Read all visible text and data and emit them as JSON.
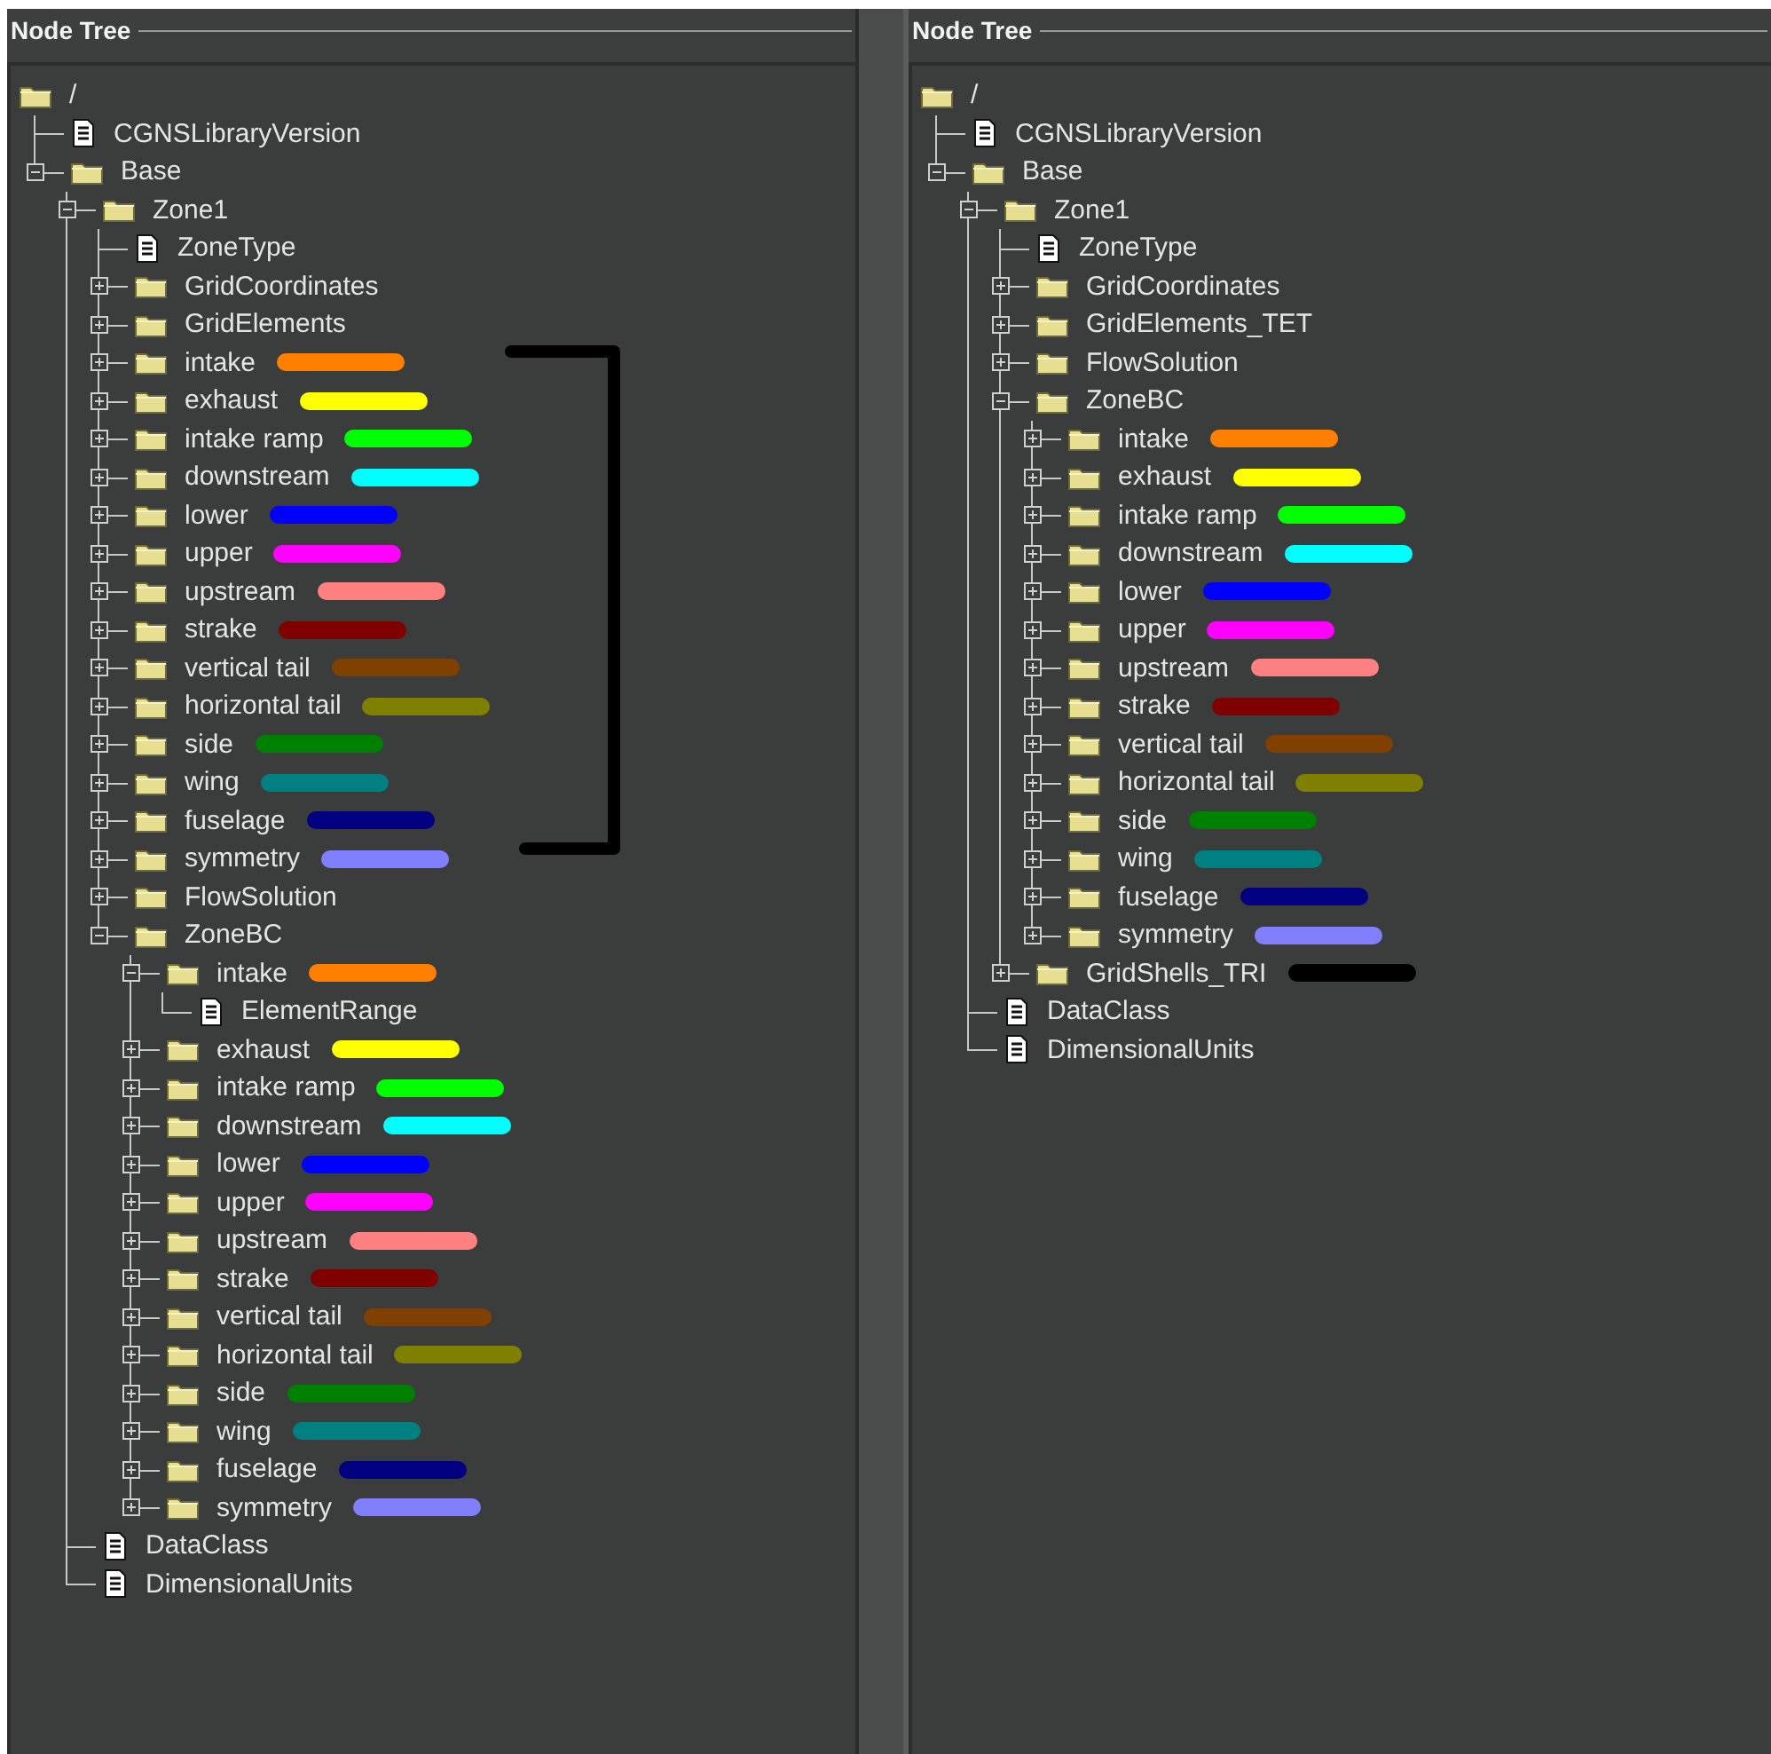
{
  "panels": [
    {
      "title": "Node Tree",
      "bracket": true,
      "tree": {
        "label": "/",
        "kind": "folder",
        "children": [
          {
            "label": "CGNSLibraryVersion",
            "kind": "file"
          },
          {
            "label": "Base",
            "kind": "folder",
            "expanded": true,
            "children": [
              {
                "label": "Zone1",
                "kind": "folder",
                "expanded": true,
                "children": [
                  {
                    "label": "ZoneType",
                    "kind": "file"
                  },
                  {
                    "label": "GridCoordinates",
                    "kind": "folder",
                    "expanded": false
                  },
                  {
                    "label": "GridElements",
                    "kind": "folder",
                    "expanded": false
                  },
                  {
                    "label": "intake",
                    "kind": "folder",
                    "expanded": false,
                    "color": "#ff8000"
                  },
                  {
                    "label": "exhaust",
                    "kind": "folder",
                    "expanded": false,
                    "color": "#ffff00"
                  },
                  {
                    "label": "intake ramp",
                    "kind": "folder",
                    "expanded": false,
                    "color": "#00ff00"
                  },
                  {
                    "label": "downstream",
                    "kind": "folder",
                    "expanded": false,
                    "color": "#00ffff"
                  },
                  {
                    "label": "lower",
                    "kind": "folder",
                    "expanded": false,
                    "color": "#0000ff"
                  },
                  {
                    "label": "upper",
                    "kind": "folder",
                    "expanded": false,
                    "color": "#ff00ff"
                  },
                  {
                    "label": "upstream",
                    "kind": "folder",
                    "expanded": false,
                    "color": "#ff8080"
                  },
                  {
                    "label": "strake",
                    "kind": "folder",
                    "expanded": false,
                    "color": "#800000"
                  },
                  {
                    "label": "vertical tail",
                    "kind": "folder",
                    "expanded": false,
                    "color": "#804000"
                  },
                  {
                    "label": "horizontal tail",
                    "kind": "folder",
                    "expanded": false,
                    "color": "#808000"
                  },
                  {
                    "label": "side",
                    "kind": "folder",
                    "expanded": false,
                    "color": "#008000"
                  },
                  {
                    "label": "wing",
                    "kind": "folder",
                    "expanded": false,
                    "color": "#008080"
                  },
                  {
                    "label": "fuselage",
                    "kind": "folder",
                    "expanded": false,
                    "color": "#000080"
                  },
                  {
                    "label": "symmetry",
                    "kind": "folder",
                    "expanded": false,
                    "color": "#8080ff"
                  },
                  {
                    "label": "FlowSolution",
                    "kind": "folder",
                    "expanded": false
                  },
                  {
                    "label": "ZoneBC",
                    "kind": "folder",
                    "expanded": true,
                    "children": [
                      {
                        "label": "intake",
                        "kind": "folder",
                        "expanded": true,
                        "color": "#ff8000",
                        "children": [
                          {
                            "label": "ElementRange",
                            "kind": "file"
                          }
                        ]
                      },
                      {
                        "label": "exhaust",
                        "kind": "folder",
                        "expanded": false,
                        "color": "#ffff00"
                      },
                      {
                        "label": "intake ramp",
                        "kind": "folder",
                        "expanded": false,
                        "color": "#00ff00"
                      },
                      {
                        "label": "downstream",
                        "kind": "folder",
                        "expanded": false,
                        "color": "#00ffff"
                      },
                      {
                        "label": "lower",
                        "kind": "folder",
                        "expanded": false,
                        "color": "#0000ff"
                      },
                      {
                        "label": "upper",
                        "kind": "folder",
                        "expanded": false,
                        "color": "#ff00ff"
                      },
                      {
                        "label": "upstream",
                        "kind": "folder",
                        "expanded": false,
                        "color": "#ff8080"
                      },
                      {
                        "label": "strake",
                        "kind": "folder",
                        "expanded": false,
                        "color": "#800000"
                      },
                      {
                        "label": "vertical tail",
                        "kind": "folder",
                        "expanded": false,
                        "color": "#804000"
                      },
                      {
                        "label": "horizontal tail",
                        "kind": "folder",
                        "expanded": false,
                        "color": "#808000"
                      },
                      {
                        "label": "side",
                        "kind": "folder",
                        "expanded": false,
                        "color": "#008000"
                      },
                      {
                        "label": "wing",
                        "kind": "folder",
                        "expanded": false,
                        "color": "#008080"
                      },
                      {
                        "label": "fuselage",
                        "kind": "folder",
                        "expanded": false,
                        "color": "#000080"
                      },
                      {
                        "label": "symmetry",
                        "kind": "folder",
                        "expanded": false,
                        "color": "#8080ff"
                      }
                    ]
                  }
                ]
              },
              {
                "label": "DataClass",
                "kind": "file"
              },
              {
                "label": "DimensionalUnits",
                "kind": "file"
              }
            ]
          }
        ]
      }
    },
    {
      "title": "Node Tree",
      "tree": {
        "label": "/",
        "kind": "folder",
        "children": [
          {
            "label": "CGNSLibraryVersion",
            "kind": "file"
          },
          {
            "label": "Base",
            "kind": "folder",
            "expanded": true,
            "children": [
              {
                "label": "Zone1",
                "kind": "folder",
                "expanded": true,
                "children": [
                  {
                    "label": "ZoneType",
                    "kind": "file"
                  },
                  {
                    "label": "GridCoordinates",
                    "kind": "folder",
                    "expanded": false
                  },
                  {
                    "label": "GridElements_TET",
                    "kind": "folder",
                    "expanded": false
                  },
                  {
                    "label": "FlowSolution",
                    "kind": "folder",
                    "expanded": false
                  },
                  {
                    "label": "ZoneBC",
                    "kind": "folder",
                    "expanded": true,
                    "children": [
                      {
                        "label": "intake",
                        "kind": "folder",
                        "expanded": false,
                        "color": "#ff8000"
                      },
                      {
                        "label": "exhaust",
                        "kind": "folder",
                        "expanded": false,
                        "color": "#ffff00"
                      },
                      {
                        "label": "intake ramp",
                        "kind": "folder",
                        "expanded": false,
                        "color": "#00ff00"
                      },
                      {
                        "label": "downstream",
                        "kind": "folder",
                        "expanded": false,
                        "color": "#00ffff"
                      },
                      {
                        "label": "lower",
                        "kind": "folder",
                        "expanded": false,
                        "color": "#0000ff"
                      },
                      {
                        "label": "upper",
                        "kind": "folder",
                        "expanded": false,
                        "color": "#ff00ff"
                      },
                      {
                        "label": "upstream",
                        "kind": "folder",
                        "expanded": false,
                        "color": "#ff8080"
                      },
                      {
                        "label": "strake",
                        "kind": "folder",
                        "expanded": false,
                        "color": "#800000"
                      },
                      {
                        "label": "vertical tail",
                        "kind": "folder",
                        "expanded": false,
                        "color": "#804000"
                      },
                      {
                        "label": "horizontal tail",
                        "kind": "folder",
                        "expanded": false,
                        "color": "#808000"
                      },
                      {
                        "label": "side",
                        "kind": "folder",
                        "expanded": false,
                        "color": "#008000"
                      },
                      {
                        "label": "wing",
                        "kind": "folder",
                        "expanded": false,
                        "color": "#008080"
                      },
                      {
                        "label": "fuselage",
                        "kind": "folder",
                        "expanded": false,
                        "color": "#000080"
                      },
                      {
                        "label": "symmetry",
                        "kind": "folder",
                        "expanded": false,
                        "color": "#8080ff"
                      }
                    ]
                  },
                  {
                    "label": "GridShells_TRI",
                    "kind": "folder",
                    "expanded": false,
                    "color": "#000000"
                  }
                ]
              },
              {
                "label": "DataClass",
                "kind": "file"
              },
              {
                "label": "DimensionalUnits",
                "kind": "file"
              }
            ]
          }
        ]
      }
    }
  ]
}
